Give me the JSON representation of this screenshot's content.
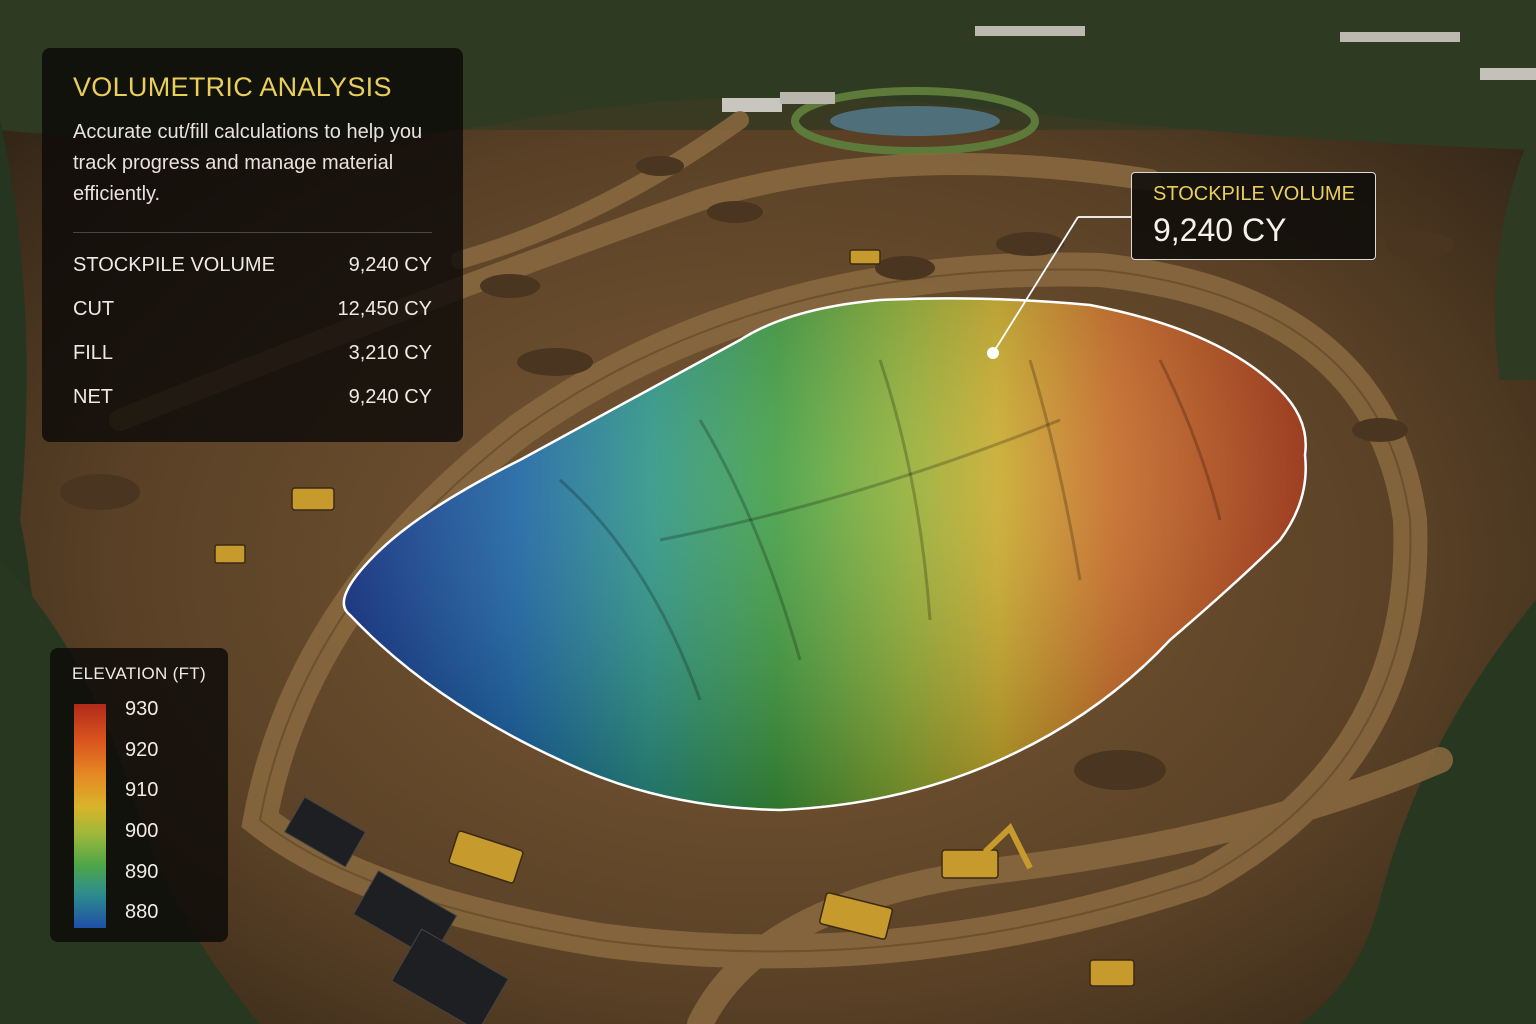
{
  "info_panel": {
    "title": "VOLUMETRIC ANALYSIS",
    "description": "Accurate cut/fill calculations to help you track progress and manage material efficiently.",
    "metrics": [
      {
        "label": "STOCKPILE VOLUME",
        "value": "9,240 CY"
      },
      {
        "label": "CUT",
        "value": "12,450 CY"
      },
      {
        "label": "FILL",
        "value": "3,210 CY"
      },
      {
        "label": "NET",
        "value": "9,240 CY"
      }
    ]
  },
  "callout": {
    "label": "STOCKPILE VOLUME",
    "value": "9,240 CY"
  },
  "legend": {
    "title": "ELEVATION (FT)",
    "ticks": [
      "930",
      "920",
      "910",
      "900",
      "890",
      "880"
    ]
  },
  "colors": {
    "accent": "#e9cf5a",
    "panel_bg": "#0c0a08",
    "elevation_high": "#b22a1a",
    "elevation_low": "#1e4fa8"
  }
}
